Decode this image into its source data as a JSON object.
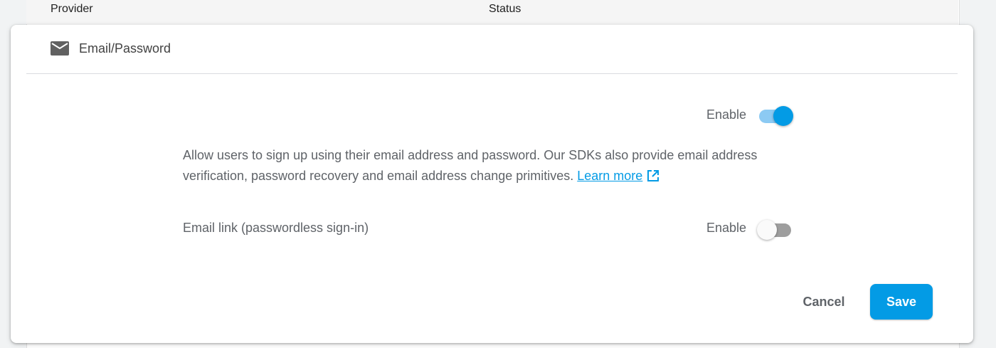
{
  "table": {
    "columns": [
      "Provider",
      "Status"
    ]
  },
  "provider": {
    "name": "Email/Password",
    "icon": "mail-icon"
  },
  "email_password": {
    "enable_label": "Enable",
    "enabled": true,
    "description": "Allow users to sign up using their email address and password. Our SDKs also provide email address verification, password recovery and email address change primitives.",
    "learn_more": "Learn more",
    "link_icon": "external-link-icon"
  },
  "email_link": {
    "label": "Email link (passwordless sign-in)",
    "enable_label": "Enable",
    "enabled": false
  },
  "actions": {
    "cancel": "Cancel",
    "save": "Save"
  },
  "colors": {
    "accent": "#039be5",
    "accent_track": "#8ccaf3",
    "off_track": "#9e9e9e",
    "text": "#5f6368"
  }
}
